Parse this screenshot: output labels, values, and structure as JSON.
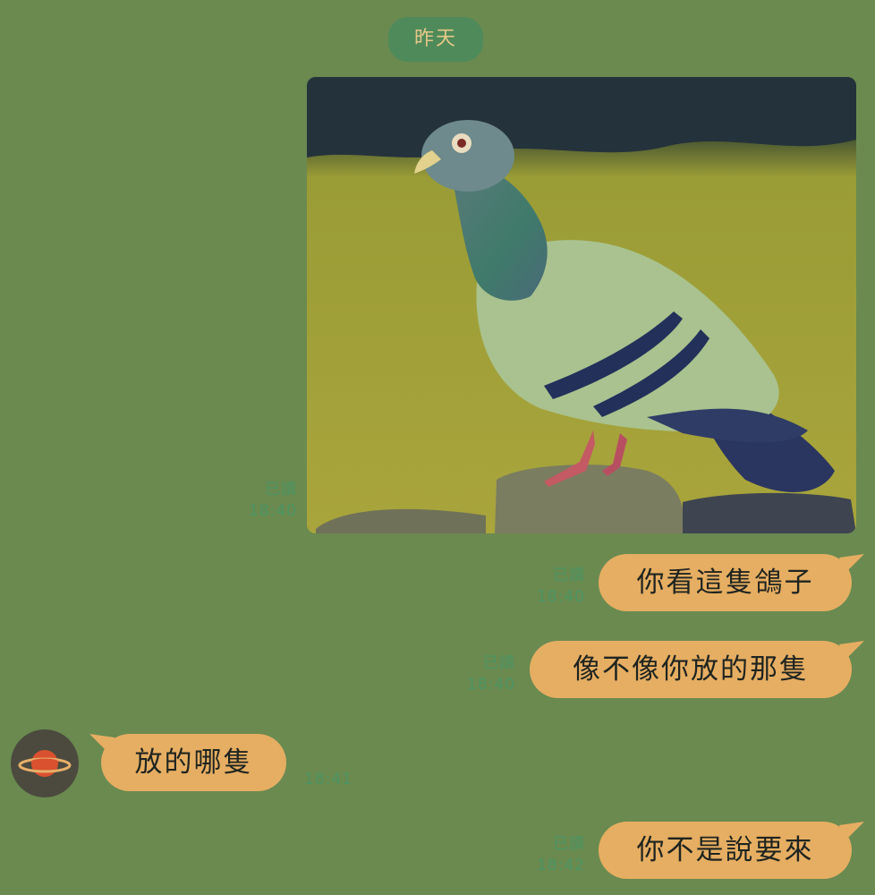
{
  "chat": {
    "date_separator": "昨天",
    "photo": {
      "read_status": "已讀",
      "time": "18:40"
    },
    "messages": [
      {
        "text": "你看這隻鴿子",
        "read_status": "已讀",
        "time": "18:40"
      },
      {
        "text": "像不像你放的那隻",
        "read_status": "已讀",
        "time": "18:40"
      },
      {
        "text": "放的哪隻",
        "time": "18:41"
      },
      {
        "text": "你不是說要來",
        "read_status": "已讀",
        "time": "18:42"
      }
    ]
  },
  "colors": {
    "background": "#6a8a50",
    "bubble": "#e6ae62",
    "date_pill": "#4f8a5a",
    "meta_text": "#4c9463"
  },
  "icons": {
    "avatar": "planet-icon"
  }
}
